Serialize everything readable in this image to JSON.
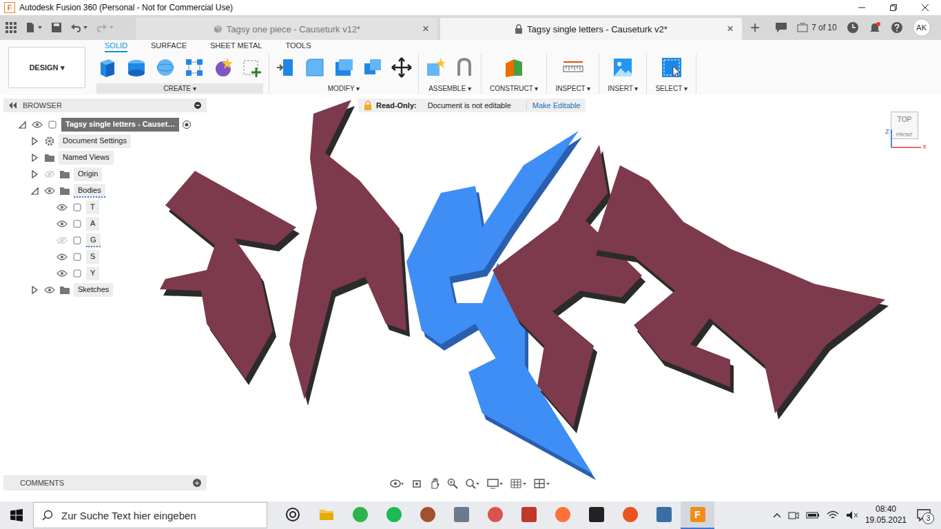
{
  "window": {
    "app_icon": "F",
    "title": "Autodesk Fusion 360 (Personal - Not for Commercial Use)"
  },
  "doc_tabs": [
    {
      "label": "Tagsy one piece - Causeturk v12*",
      "selected": false,
      "locked": false,
      "close": "×"
    },
    {
      "label": "Tagsy single letters - Causeturk v2*",
      "selected": true,
      "locked": true,
      "close": "×"
    }
  ],
  "new_tab": "+",
  "job_status": "7 of 10",
  "user": "AK",
  "workspace": "DESIGN ▾",
  "ribbon_tabs": [
    {
      "label": "SOLID",
      "selected": true
    },
    {
      "label": "SURFACE",
      "selected": false
    },
    {
      "label": "SHEET METAL",
      "selected": false
    },
    {
      "label": "TOOLS",
      "selected": false
    }
  ],
  "ribbon_groups": [
    "CREATE ▾",
    "MODIFY ▾",
    "ASSEMBLE ▾",
    "CONSTRUCT ▾",
    "INSPECT ▾",
    "INSERT ▾",
    "SELECT ▾"
  ],
  "banner": {
    "label": "Read-Only:",
    "message": "Document is not editable",
    "action": "Make Editable"
  },
  "browser": {
    "title": "BROWSER",
    "root": "Tagsy single letters - Causet…",
    "items": [
      {
        "label": "Document Settings",
        "kind": "settings",
        "depth": 1,
        "expander": "collapsed",
        "selected": false
      },
      {
        "label": "Named Views",
        "kind": "views",
        "depth": 1,
        "expander": "collapsed",
        "selected": false
      },
      {
        "label": "Origin",
        "kind": "folder",
        "depth": 1,
        "expander": "collapsed",
        "visible": false,
        "selected": false
      },
      {
        "label": "Bodies",
        "kind": "folder",
        "depth": 1,
        "expander": "expanded",
        "visible": true,
        "selected": true
      },
      {
        "label": "T",
        "kind": "body",
        "depth": 2,
        "expander": "none",
        "visible": true,
        "selected": false
      },
      {
        "label": "A",
        "kind": "body",
        "depth": 2,
        "expander": "none",
        "visible": true,
        "selected": false
      },
      {
        "label": "G",
        "kind": "body",
        "depth": 2,
        "expander": "none",
        "visible": false,
        "selected": true
      },
      {
        "label": "S",
        "kind": "body",
        "depth": 2,
        "expander": "none",
        "visible": true,
        "selected": false
      },
      {
        "label": "Y",
        "kind": "body",
        "depth": 2,
        "expander": "none",
        "visible": true,
        "selected": false
      },
      {
        "label": "Sketches",
        "kind": "folder",
        "depth": 1,
        "expander": "collapsed",
        "visible": true,
        "selected": false
      }
    ]
  },
  "viewcube": {
    "top": "TOP",
    "front": "FRONT",
    "x": "X",
    "z": "Z"
  },
  "comments": {
    "title": "COMMENTS",
    "add": "+"
  },
  "taskbar": {
    "search": "Zur Suche Text hier eingeben",
    "time": "08:40",
    "date": "19.05.2021",
    "notifications": "3"
  }
}
